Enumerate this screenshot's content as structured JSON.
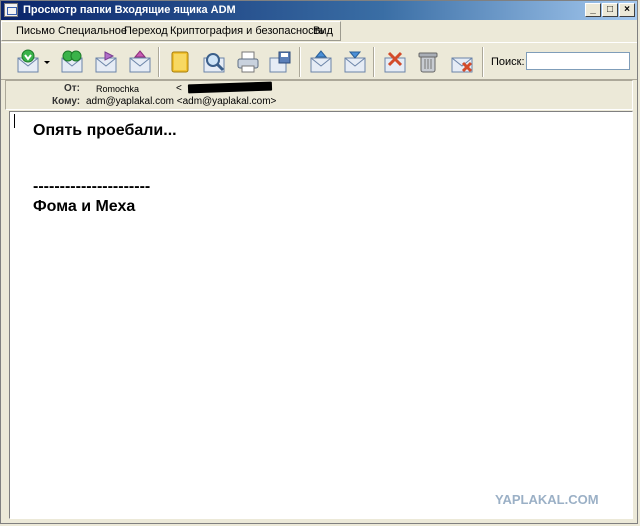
{
  "window": {
    "title": "Просмотр папки Входящие ящика ADM",
    "buttons": {
      "minimize": "_",
      "maximize": "□",
      "close": "×"
    }
  },
  "menu": {
    "items": [
      {
        "label": "Письмо"
      },
      {
        "label": "Специальное"
      },
      {
        "label": "Переход"
      },
      {
        "label": "Криптография и безопасность"
      },
      {
        "label": "Вид"
      }
    ]
  },
  "toolbar": {
    "buttons": [
      {
        "icon": "get-mail-icon"
      },
      {
        "icon": "dropdown-arrow-icon"
      },
      {
        "icon": "reply-all-icon"
      },
      {
        "icon": "forward-icon"
      },
      {
        "icon": "send-receive-icon"
      },
      {
        "icon": "address-book-icon"
      },
      {
        "icon": "search-icon"
      },
      {
        "icon": "print-icon"
      },
      {
        "icon": "save-icon"
      },
      {
        "icon": "previous-message-icon"
      },
      {
        "icon": "next-message-icon"
      },
      {
        "icon": "junk-icon"
      },
      {
        "icon": "delete-icon"
      },
      {
        "icon": "delete-from-server-icon"
      }
    ],
    "search": {
      "label": "Поиск:",
      "value": ""
    }
  },
  "headers": {
    "from_label": "От:",
    "from_name": "Romochka",
    "from_email": "<",
    "to_label": "Кому:",
    "to_value": "adm@yaplakal.com <adm@yaplakal.com>"
  },
  "message": {
    "lines": [
      "Опять проебали...",
      "----------------------",
      "Фома и Меха"
    ]
  },
  "watermark": "YAPLAKAL.COM",
  "colors": {
    "title_start": "#0a246a",
    "title_end": "#a6caf0",
    "chrome": "#ece9d8"
  }
}
